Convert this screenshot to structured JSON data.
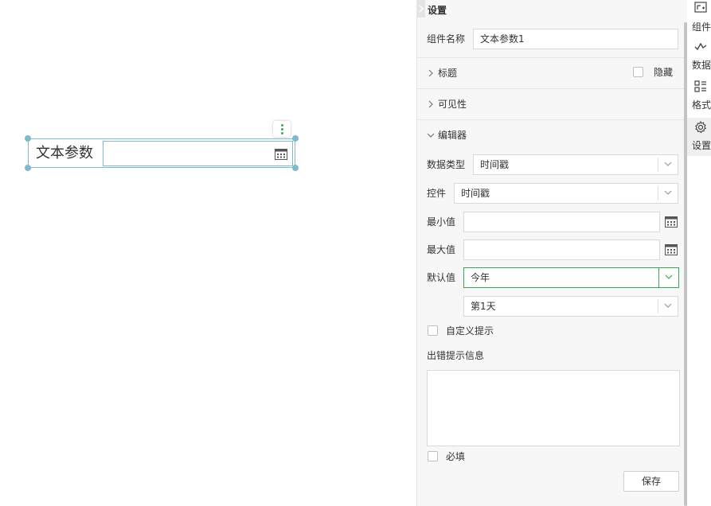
{
  "canvas": {
    "widget_label": "文本参数"
  },
  "panel": {
    "title": "设置",
    "component_name_label": "组件名称",
    "component_name_value": "文本参数1",
    "sections": {
      "title_label": "标题",
      "hide_label": "隐藏",
      "visibility_label": "可见性",
      "editor_label": "编辑器"
    },
    "editor": {
      "data_type_label": "数据类型",
      "data_type_value": "时间戳",
      "control_label": "控件",
      "control_value": "时间戳",
      "min_label": "最小值",
      "min_value": "",
      "max_label": "最大值",
      "max_value": "",
      "default_label": "默认值",
      "default_value": "今年",
      "default_sub_value": "第1天",
      "custom_hint_label": "自定义提示",
      "error_hint_label": "出错提示信息",
      "error_hint_value": "",
      "required_label": "必填",
      "save_label": "保存"
    }
  },
  "rail": {
    "items": [
      {
        "label": "组件",
        "icon": "component-icon"
      },
      {
        "label": "数据",
        "icon": "data-icon"
      },
      {
        "label": "格式",
        "icon": "format-icon"
      },
      {
        "label": "设置",
        "icon": "gear-icon"
      }
    ]
  },
  "colors": {
    "accent": "#3aa757",
    "selection": "#7fb9cc",
    "panel_bg": "#f7f7f7",
    "border": "#d9d9d9"
  }
}
